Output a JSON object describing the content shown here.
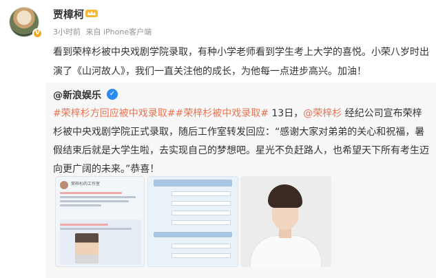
{
  "post": {
    "user_name": "贾樟柯",
    "time": "3小时前",
    "source": "来自 iPhone客户端",
    "text": "看到荣梓杉被中央戏剧学院录取，有种小学老师看到学生考上大学的喜悦。小荣八岁时出演了《山河故人》，我们一直关注他的成长，为他每一点进步高兴。加油！"
  },
  "repost": {
    "user_name": "@新浪娱乐",
    "tag1": "#荣梓杉方回应被中戏录取#",
    "tag2": "#荣梓杉被中戏录取#",
    "date": " 13日，",
    "mention": "@荣梓杉",
    "text": " 经纪公司宣布荣梓杉被中央戏剧学院正式录取，随后工作室转发回应：“感谢大家对弟弟的关心和祝福，暑假结束后就是大学生啦，去实现自己的梦想吧。星光不负赶路人，也希望天下所有考生迈向更广阔的未来。”恭喜！"
  },
  "thumb1": {
    "title": "荣梓杉的工作室"
  },
  "icons": {
    "vip": "vip-crown-icon",
    "verify": "verified-v-icon",
    "avatar_badge": "badge-icon"
  },
  "colors": {
    "tag": "#eb7350",
    "verify": "#2a8cf0",
    "repost_bg": "#f7f7f7"
  }
}
